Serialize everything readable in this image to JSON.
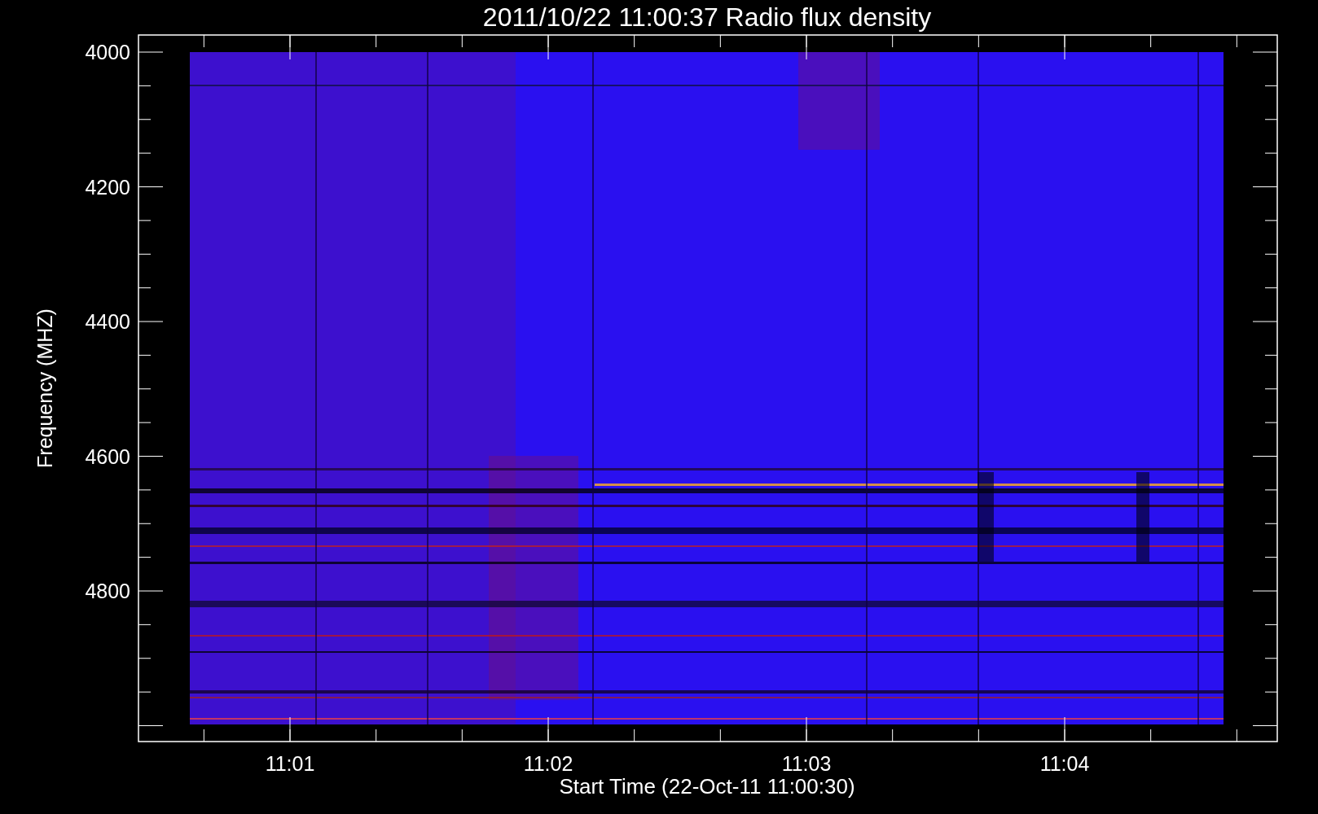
{
  "title": "2011/10/22 11:00:37 Radio flux density",
  "ylabel": "Frequency (MHZ)",
  "xlabel": "Start Time (22-Oct-11 11:00:30)",
  "yticks": [
    "4000",
    "4200",
    "4400",
    "4600",
    "4800"
  ],
  "xticks": [
    "11:01",
    "11:02",
    "11:03",
    "11:04"
  ]
}
